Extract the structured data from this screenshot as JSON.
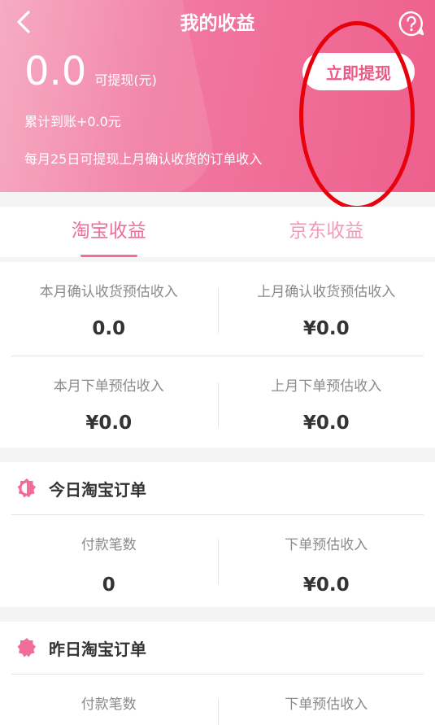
{
  "header": {
    "title": "我的收益",
    "balance_amount": "0.0",
    "balance_label": "可提现(元)",
    "withdraw_label": "立即提现",
    "accumulated": "累计到账+0.0元",
    "notice": "每月25日可提现上月确认收货的订单收入"
  },
  "tabs": [
    {
      "label": "淘宝收益",
      "active": true
    },
    {
      "label": "京东收益",
      "active": false
    }
  ],
  "stats": {
    "rows": [
      [
        {
          "label": "本月确认收货预估收入",
          "value": "0.0"
        },
        {
          "label": "上月确认收货预估收入",
          "value": "¥0.0"
        }
      ],
      [
        {
          "label": "本月下单预估收入",
          "value": "¥0.0"
        },
        {
          "label": "上月下单预估收入",
          "value": "¥0.0"
        }
      ]
    ]
  },
  "today": {
    "title": "今日淘宝订单",
    "icon": "half-moon-icon",
    "cells": [
      {
        "label": "付款笔数",
        "value": "0"
      },
      {
        "label": "下单预估收入",
        "value": "¥0.0"
      }
    ]
  },
  "yesterday": {
    "title": "昨日淘宝订单",
    "icon": "crescent-moon-icon",
    "cells": [
      {
        "label": "付款笔数"
      },
      {
        "label": "下单预估收入"
      }
    ]
  },
  "colors": {
    "brand_pink": "#ee5f8c",
    "accent_text": "#ef6f98",
    "annotation_red": "#e8000b"
  }
}
